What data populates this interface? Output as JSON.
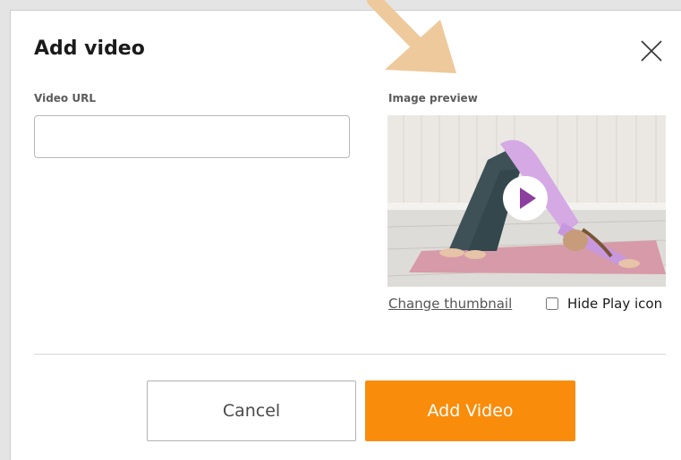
{
  "dialog": {
    "title": "Add video",
    "close_icon": "close-icon"
  },
  "form": {
    "url_label": "Video URL",
    "url_value": "",
    "url_placeholder": "",
    "preview_label": "Image preview"
  },
  "preview": {
    "play_icon": "play-icon",
    "change_thumbnail_label": "Change thumbnail",
    "hide_play_label": "Hide Play icon",
    "hide_play_checked": false
  },
  "footer": {
    "cancel_label": "Cancel",
    "add_label": "Add Video"
  },
  "colors": {
    "accent": "#f98c0a",
    "arrow": "#eec99b",
    "play_triangle": "#8b3f9e"
  }
}
